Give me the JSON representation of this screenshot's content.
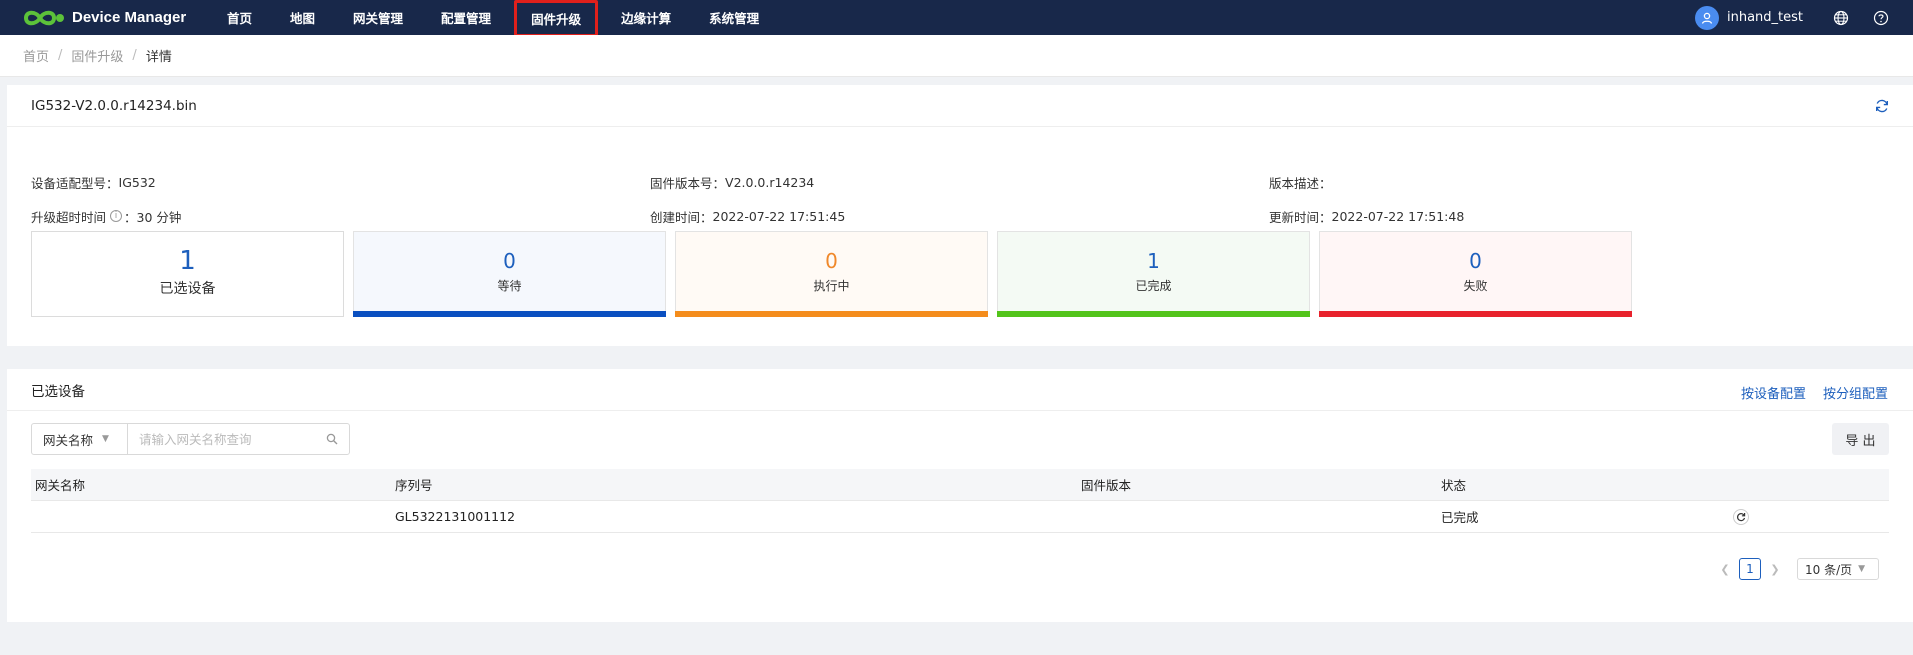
{
  "app": {
    "title": "Device Manager",
    "nav": [
      "首页",
      "地图",
      "网关管理",
      "配置管理",
      "固件升级",
      "边缘计算",
      "系统管理"
    ],
    "active_nav": "固件升级",
    "username": "inhand_test"
  },
  "breadcrumb": [
    "首页",
    "固件升级",
    "详情"
  ],
  "firmware": {
    "title": "IG532-V2.0.0.r14234.bin",
    "model_label": "设备适配型号：",
    "model_value": "IG532",
    "version_label": "固件版本号：",
    "version_value": "V2.0.0.r14234",
    "desc_label": "版本描述：",
    "desc_value": "",
    "timeout_label": "升级超时时间",
    "timeout_value": "：30 分钟",
    "created_label": "创建时间：",
    "created_value": "2022-07-22 17:51:45",
    "updated_label": "更新时间：",
    "updated_value": "2022-07-22 17:51:48"
  },
  "stats": {
    "selected": {
      "value": "1",
      "label": "已选设备"
    },
    "waiting": {
      "value": "0",
      "label": "等待",
      "color": "#1d5fbd",
      "bg": "#f5f8fd",
      "bar": "#0a4fc0"
    },
    "running": {
      "value": "0",
      "label": "执行中",
      "color": "#f0882a",
      "bg": "#fffaf5",
      "bar": "#f48c1c"
    },
    "done": {
      "value": "1",
      "label": "已完成",
      "color": "#1d5fbd",
      "bg": "#f4faf4",
      "bar": "#52c41a"
    },
    "failed": {
      "value": "0",
      "label": "失败",
      "color": "#1d5fbd",
      "bg": "#fff6f6",
      "bar": "#e8222c"
    }
  },
  "devices_panel": {
    "title": "已选设备",
    "link_by_device": "按设备配置",
    "link_by_group": "按分组配置",
    "filter_select": "网关名称",
    "search_placeholder": "请输入网关名称查询",
    "export": "导 出",
    "columns": [
      "网关名称",
      "序列号",
      "固件版本",
      "状态"
    ],
    "rows": [
      {
        "name": "",
        "serial": "GL5322131001112",
        "firmware": "",
        "status": "已完成"
      }
    ],
    "pager": {
      "page": "1",
      "size": "10 条/页"
    }
  }
}
